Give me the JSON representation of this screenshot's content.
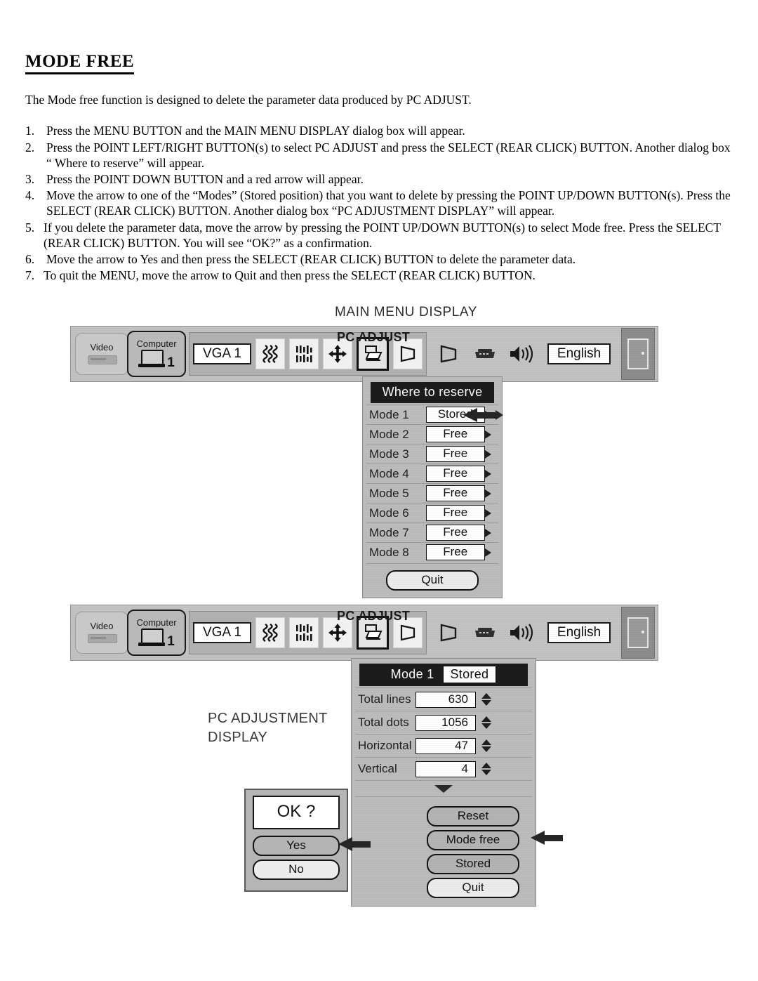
{
  "document": {
    "title": "MODE FREE",
    "intro": "The Mode free function is designed to delete the parameter data produced by PC ADJUST.",
    "steps": [
      {
        "num": "1.",
        "text": "Press the MENU BUTTON and the MAIN MENU DISPLAY dialog box will appear."
      },
      {
        "num": "2.",
        "text": "Press the POINT LEFT/RIGHT BUTTON(s) to select PC ADJUST and press the SELECT (REAR CLICK) BUTTON. Another dialog box “ Where to reserve” will appear."
      },
      {
        "num": "3.",
        "text": "Press the POINT DOWN BUTTON and a red arrow will appear."
      },
      {
        "num": "4.",
        "text": "Move the arrow to one of the “Modes” (Stored position) that you want to delete by pressing the POINT UP/DOWN BUTTON(s). Press the SELECT (REAR CLICK) BUTTON. Another dialog box “PC ADJUSTMENT DISPLAY” will appear."
      },
      {
        "num": "5.",
        "text": "If you delete the parameter data, move the arrow by pressing the POINT UP/DOWN BUTTON(s) to select Mode free. Press the SELECT (REAR CLICK) BUTTON. You will see “OK?” as a confirmation."
      },
      {
        "num": "6.",
        "text": "Move the arrow to Yes and then press the SELECT (REAR CLICK) BUTTON to delete the parameter data."
      },
      {
        "num": "7.",
        "text": "To quit the MENU, move the arrow to Quit and then press the SELECT (REAR CLICK) BUTTON."
      }
    ]
  },
  "figure_main": {
    "caption": "MAIN MENU DISPLAY",
    "menubar": {
      "title": "PC ADJUST",
      "video_tab": {
        "label": "Video",
        "icon": "vcr-icon"
      },
      "computer_tab": {
        "label": "Computer",
        "number": "1",
        "icon": "laptop-icon"
      },
      "source_value": "VGA 1",
      "icons": [
        {
          "name": "fine-sync-icon"
        },
        {
          "name": "total-dots-icon"
        },
        {
          "name": "position-icon"
        },
        {
          "name": "pc-adjust-icon",
          "selected": true
        },
        {
          "name": "keystone-icon"
        }
      ],
      "right_icons": [
        {
          "name": "keystone-icon"
        },
        {
          "name": "remote-control-icon"
        },
        {
          "name": "volume-icon"
        }
      ],
      "language_value": "English",
      "exit_icon": "door-exit-icon"
    },
    "dialog": {
      "header": "Where to reserve",
      "rows": [
        {
          "label": "Mode 1",
          "value": "Stored",
          "pointer": true
        },
        {
          "label": "Mode 2",
          "value": "Free",
          "pointer": false
        },
        {
          "label": "Mode 3",
          "value": "Free",
          "pointer": false
        },
        {
          "label": "Mode 4",
          "value": "Free",
          "pointer": false
        },
        {
          "label": "Mode 5",
          "value": "Free",
          "pointer": false
        },
        {
          "label": "Mode 6",
          "value": "Free",
          "pointer": false
        },
        {
          "label": "Mode 7",
          "value": "Free",
          "pointer": false
        },
        {
          "label": "Mode 8",
          "value": "Free",
          "pointer": false
        }
      ],
      "quit_label": "Quit"
    }
  },
  "figure_adjust": {
    "label_line1": "PC ADJUSTMENT",
    "label_line2": "DISPLAY",
    "menubar": {
      "title": "PC ADJUST",
      "video_tab": {
        "label": "Video",
        "icon": "vcr-icon"
      },
      "computer_tab": {
        "label": "Computer",
        "number": "1",
        "icon": "laptop-icon"
      },
      "source_value": "VGA 1",
      "language_value": "English",
      "exit_icon": "door-exit-icon"
    },
    "dialog": {
      "header_label": "Mode 1",
      "header_value": "Stored",
      "rows": [
        {
          "label": "Total lines",
          "value": "630"
        },
        {
          "label": "Total dots",
          "value": "1056"
        },
        {
          "label": "Horizontal",
          "value": "47"
        },
        {
          "label": "Vertical",
          "value": "4"
        }
      ],
      "scroll_icon": "scroll-down-icon",
      "buttons": [
        {
          "label": "Reset",
          "pointer": false
        },
        {
          "label": "Mode free",
          "pointer": true
        },
        {
          "label": "Stored",
          "pointer": false
        },
        {
          "label": "Quit",
          "pointer": false,
          "highlight": true
        }
      ]
    },
    "confirm": {
      "title": "OK ?",
      "yes_label": "Yes",
      "no_label": "No",
      "pointer_on": "Yes"
    }
  }
}
